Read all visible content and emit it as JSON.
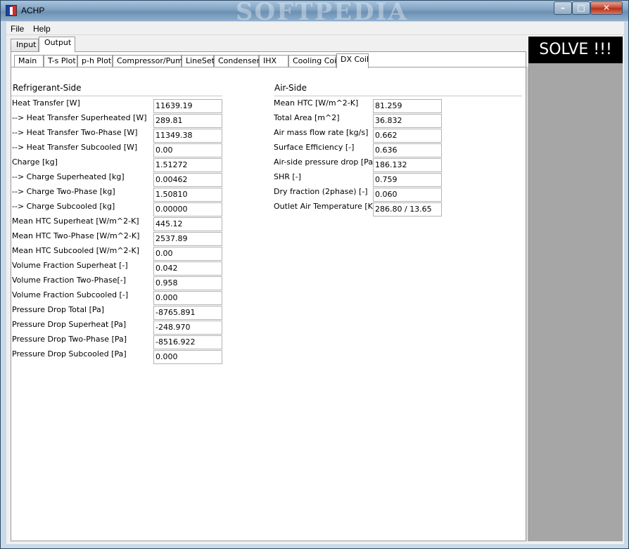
{
  "window": {
    "title": "ACHP",
    "watermark": "SOFTPEDIA",
    "min_glyph": "–",
    "max_glyph": "□",
    "close_glyph": "✕"
  },
  "menu": [
    "File",
    "Help"
  ],
  "outer_tabs": [
    "Input",
    "Output"
  ],
  "inner_tabs": [
    "Main",
    "T-s Plot",
    "p-h Plot",
    "Compressor/Pump",
    "LineSet",
    "Condenser",
    "IHX",
    "Cooling Coil",
    "DX Coil"
  ],
  "solve_label": "SOLVE !!!",
  "refrigerant_side": {
    "heading": "Refrigerant-Side",
    "rows": [
      {
        "label": "Heat Transfer [W]",
        "value": "11639.19"
      },
      {
        "label": "--> Heat Transfer Superheated [W]",
        "value": "289.81"
      },
      {
        "label": "--> Heat Transfer Two-Phase [W]",
        "value": "11349.38"
      },
      {
        "label": "--> Heat Transfer Subcooled [W]",
        "value": "0.00"
      },
      {
        "label": "Charge [kg]",
        "value": "1.51272"
      },
      {
        "label": "--> Charge Superheated [kg]",
        "value": "0.00462"
      },
      {
        "label": "--> Charge Two-Phase [kg]",
        "value": "1.50810"
      },
      {
        "label": "--> Charge Subcooled [kg]",
        "value": "0.00000"
      },
      {
        "label": "Mean HTC Superheat [W/m^2-K]",
        "value": "445.12"
      },
      {
        "label": "Mean HTC Two-Phase [W/m^2-K]",
        "value": "2537.89"
      },
      {
        "label": "Mean HTC Subcooled [W/m^2-K]",
        "value": "0.00"
      },
      {
        "label": "Volume Fraction Superheat [-]",
        "value": "0.042"
      },
      {
        "label": "Volume Fraction Two-Phase[-]",
        "value": "0.958"
      },
      {
        "label": "Volume Fraction Subcooled [-]",
        "value": "0.000"
      },
      {
        "label": "Pressure Drop Total [Pa]",
        "value": "-8765.891"
      },
      {
        "label": "Pressure Drop Superheat [Pa]",
        "value": "-248.970"
      },
      {
        "label": "Pressure Drop Two-Phase [Pa]",
        "value": "-8516.922"
      },
      {
        "label": "Pressure Drop Subcooled [Pa]",
        "value": "0.000"
      }
    ]
  },
  "air_side": {
    "heading": "Air-Side",
    "rows": [
      {
        "label": "Mean HTC [W/m^2-K]",
        "value": "81.259"
      },
      {
        "label": "Total Area [m^2]",
        "value": "36.832"
      },
      {
        "label": "Air mass flow rate [kg/s]",
        "value": "0.662"
      },
      {
        "label": "Surface Efficiency [-]",
        "value": "0.636"
      },
      {
        "label": "Air-side pressure drop [Pa]",
        "value": "186.132"
      },
      {
        "label": "SHR [-]",
        "value": "0.759"
      },
      {
        "label": "Dry fraction (2phase) [-]",
        "value": "0.060"
      },
      {
        "label": "Outlet Air Temperature [K/C]",
        "value": "286.80 / 13.65"
      }
    ]
  }
}
